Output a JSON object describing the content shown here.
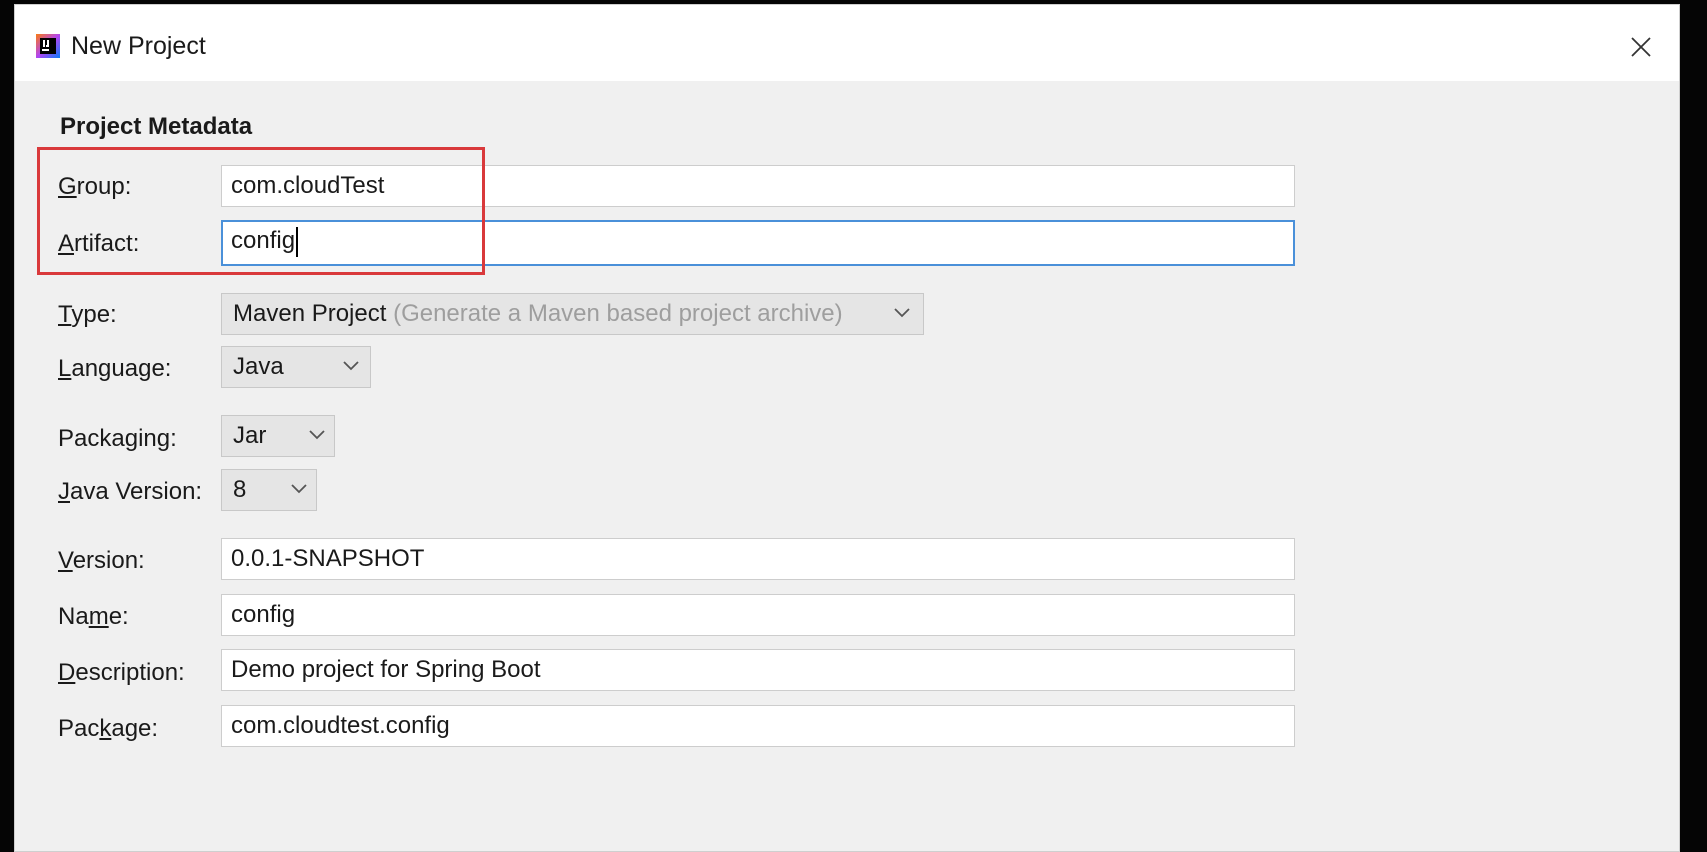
{
  "window": {
    "title": "New Project",
    "app_icon": "intellij-icon",
    "close_icon": "close-icon"
  },
  "section_title": "Project Metadata",
  "fields": {
    "group": {
      "label_pre": "",
      "label_mnemonic": "G",
      "label_post": "roup:",
      "value": "com.cloudTest"
    },
    "artifact": {
      "label_pre": "",
      "label_mnemonic": "A",
      "label_post": "rtifact:",
      "value": "config"
    },
    "type": {
      "label_pre": "",
      "label_mnemonic": "T",
      "label_post": "ype:",
      "value": "Maven Project",
      "hint": "(Generate a Maven based project archive)"
    },
    "language": {
      "label_pre": "",
      "label_mnemonic": "L",
      "label_post": "anguage:",
      "value": "Java"
    },
    "packaging": {
      "label_pre": "Packa",
      "label_mnemonic": "g",
      "label_post": "ing:",
      "value": "Jar"
    },
    "java_version": {
      "label_pre": "",
      "label_mnemonic": "J",
      "label_post": "ava Version:",
      "value": "8"
    },
    "version": {
      "label_pre": "",
      "label_mnemonic": "V",
      "label_post": "ersion:",
      "value": "0.0.1-SNAPSHOT"
    },
    "name": {
      "label_pre": "Na",
      "label_mnemonic": "m",
      "label_post": "e:",
      "value": "config"
    },
    "description": {
      "label_pre": "",
      "label_mnemonic": "D",
      "label_post": "escription:",
      "value": "Demo project for Spring Boot"
    },
    "package": {
      "label_pre": "Pac",
      "label_mnemonic": "k",
      "label_post": "age:",
      "value": "com.cloudtest.config"
    }
  },
  "colors": {
    "highlight_border": "#d9393b",
    "focus_border": "#4a90d9",
    "dialog_bg": "#f0f0f0"
  }
}
